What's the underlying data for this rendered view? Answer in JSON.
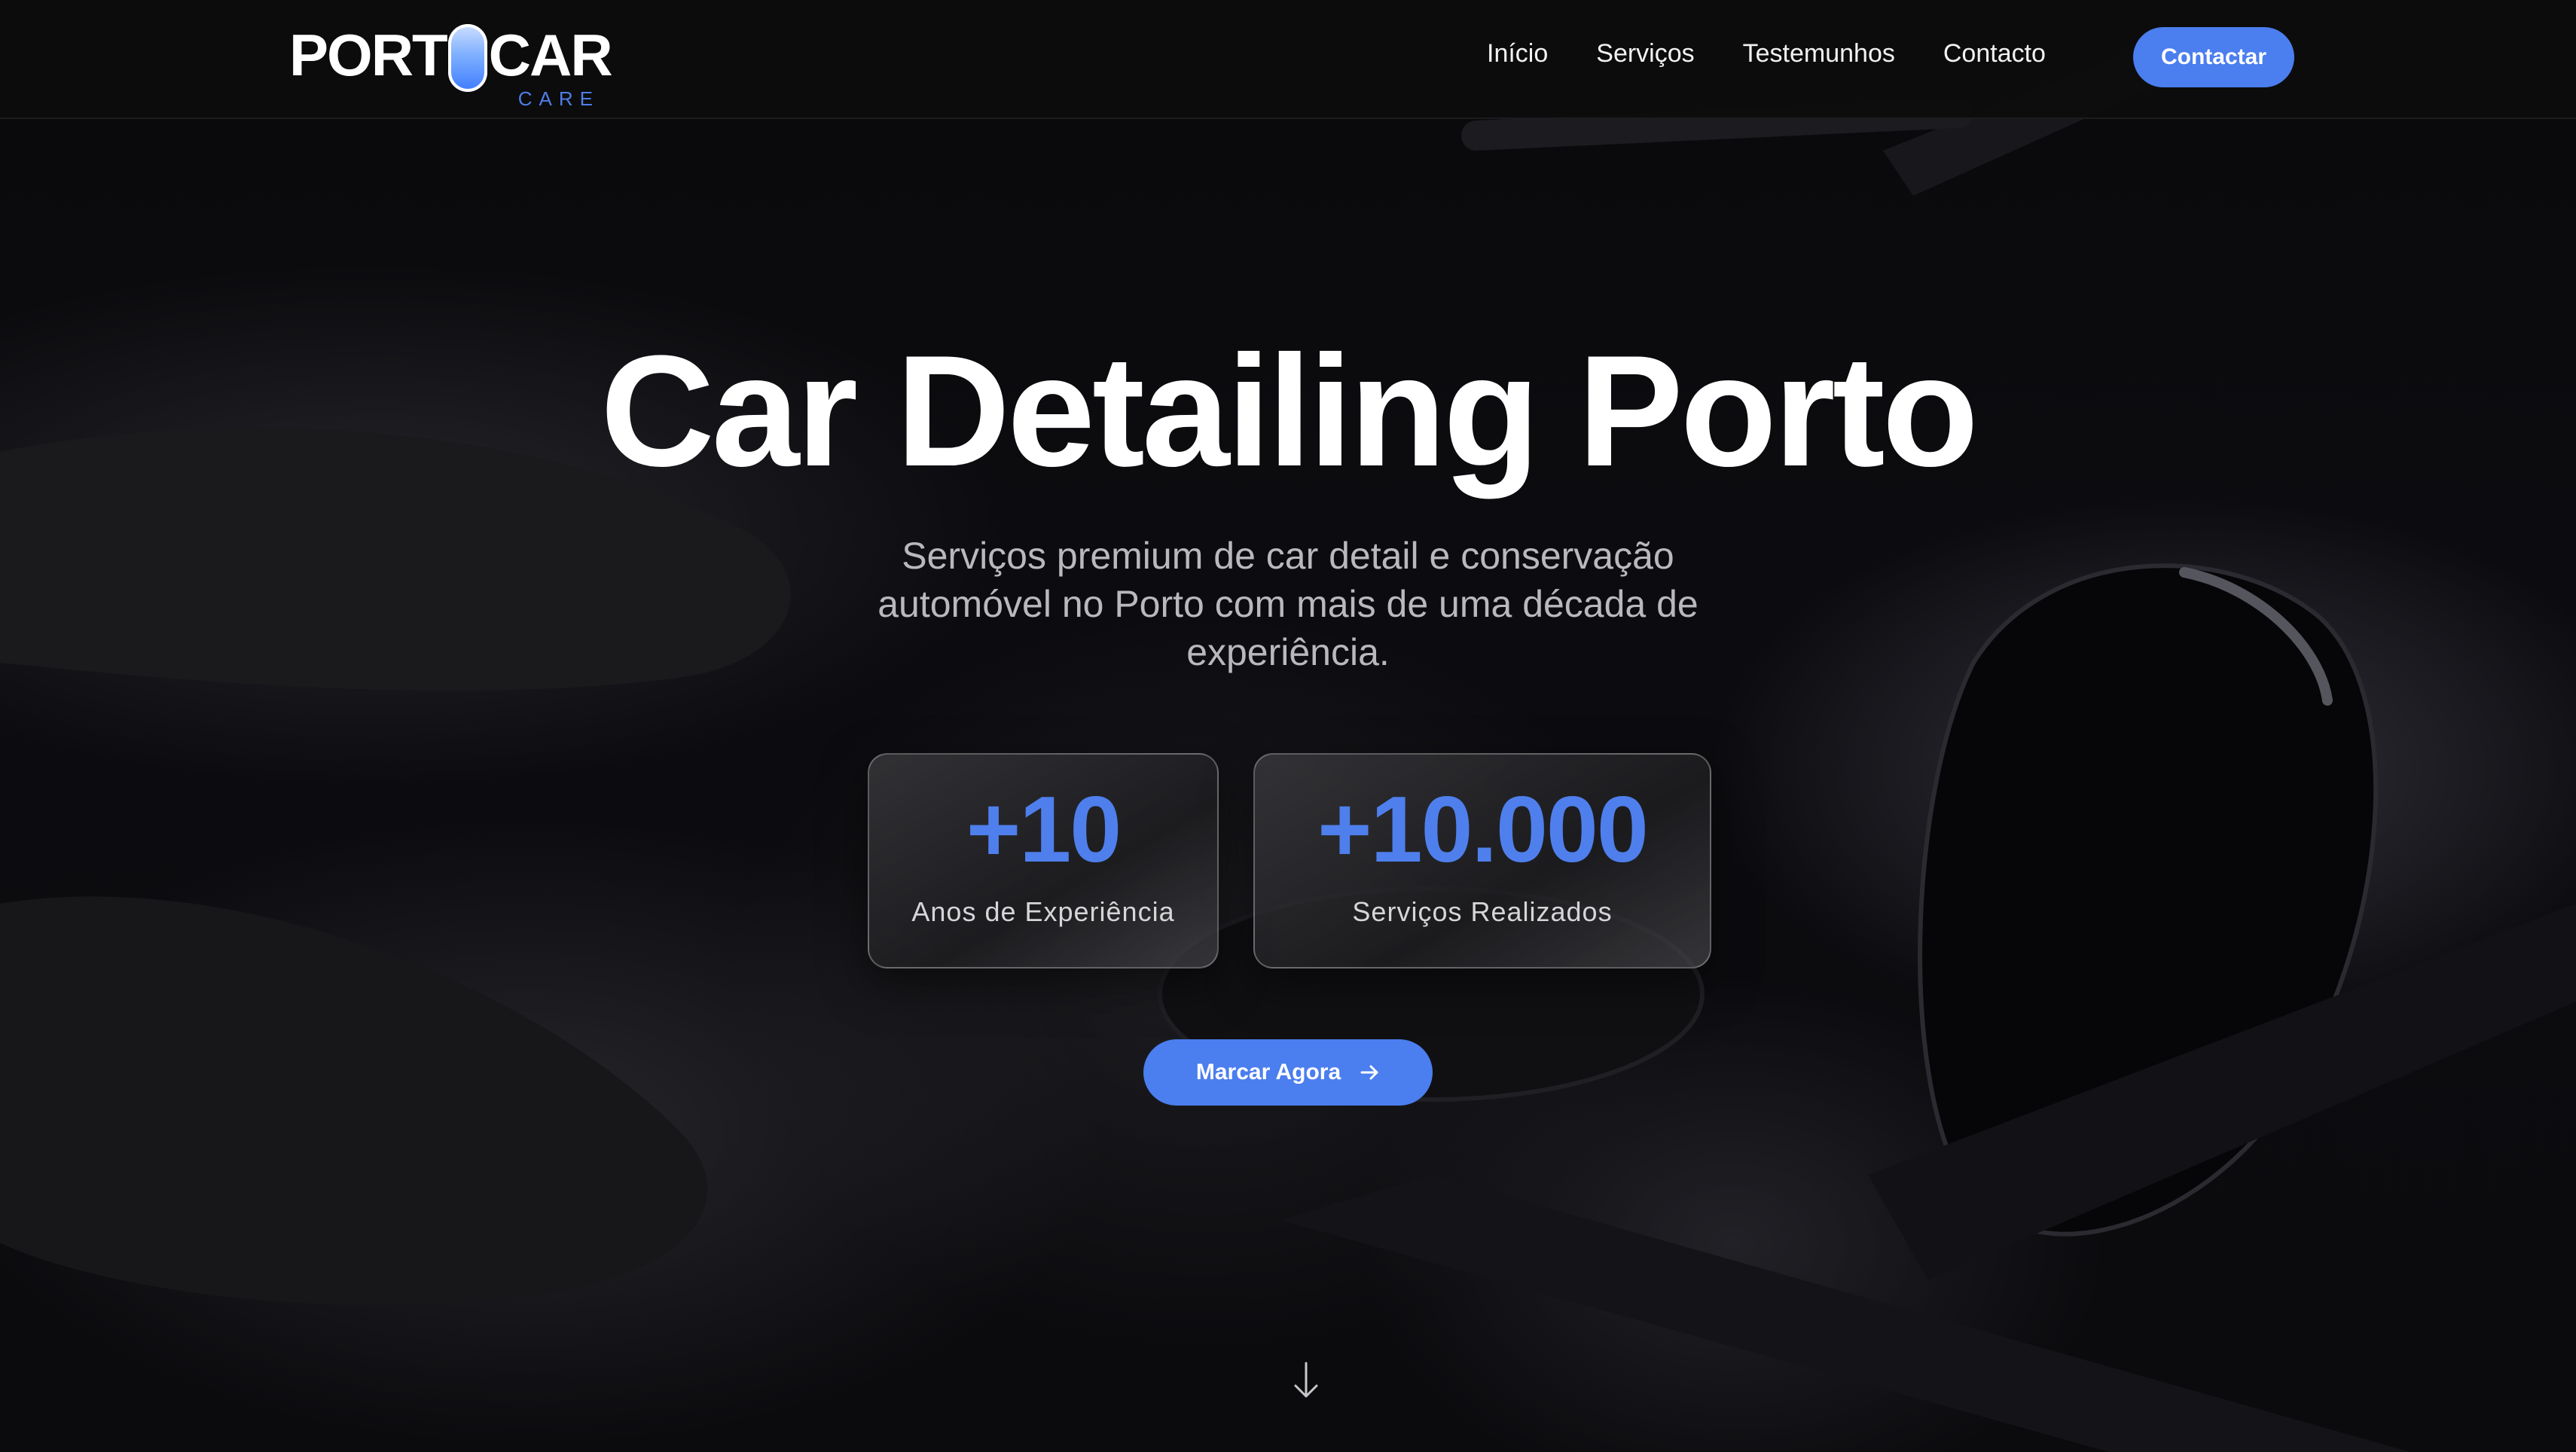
{
  "nav": {
    "logo_main": "PORTOCAR",
    "logo_main_left": "PORT",
    "logo_main_right": "CAR",
    "logo_sub": "CARE",
    "links": [
      "Início",
      "Serviços",
      "Testemunhos",
      "Contacto"
    ],
    "cta_label": "Contactar"
  },
  "hero": {
    "title": "Car Detailing Porto",
    "subtitle": "Serviços premium de car detail e conservação automóvel no Porto com mais de uma década de experiência.",
    "stats": [
      {
        "value": "+10",
        "label": "Anos de Experiência"
      },
      {
        "value": "+10.000",
        "label": "Serviços Realizados"
      }
    ],
    "cta_label": "Marcar Agora",
    "cta_icon": "arrow-right-icon",
    "scroll_icon": "arrow-down-icon"
  },
  "colors": {
    "accent": "#4b7eee",
    "background": "#0a0a0c",
    "navbar": "#0c0c0d",
    "text": "#ffffff",
    "subtitle": "#b9b9bd"
  }
}
